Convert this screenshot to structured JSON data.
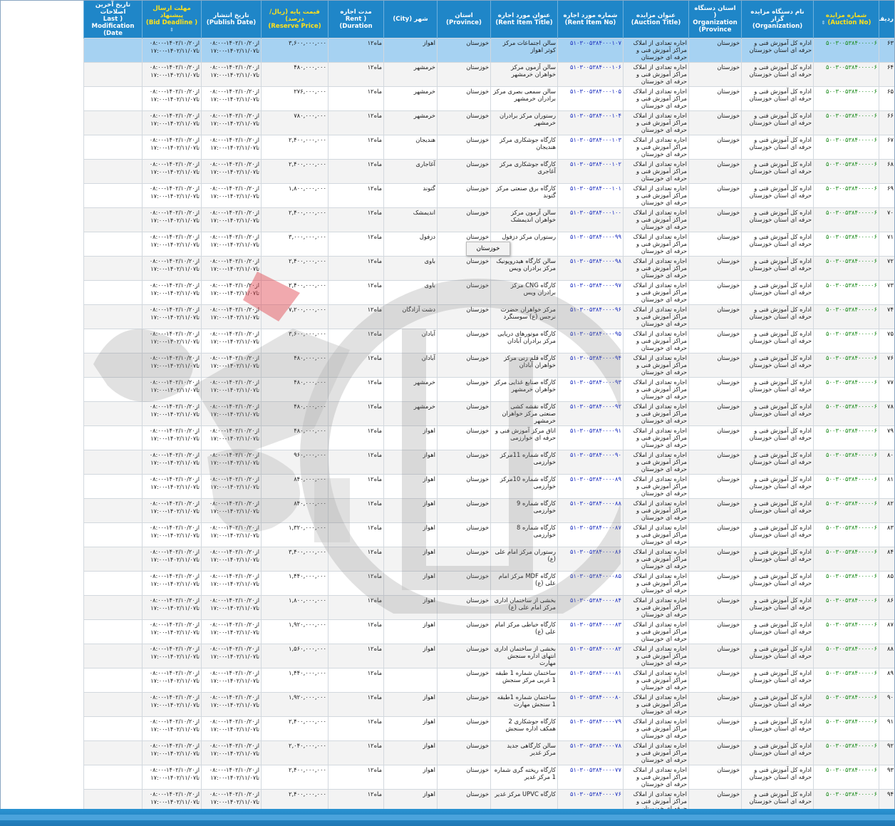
{
  "headers": {
    "row_no": "ردیف",
    "auction_no": "شماره مزایده",
    "auction_no_en": "(Auction No)",
    "organization": "نام دستگاه مزایده گزار",
    "organization_en": "(Organization)",
    "org_province": "استان دستگاه",
    "org_province_en": "( Organization Province)",
    "auction_title": "عنوان مزایده",
    "auction_title_en": "(Auction Title)",
    "rent_item_no": "شماره مورد اجاره",
    "rent_item_no_en": "(Rent Item No)",
    "rent_item_title": "عنوان مورد اجاره",
    "rent_item_title_en": "(Rent Item Title)",
    "province": "استان",
    "province_en": "(Province)",
    "city": "شهر (City)",
    "duration": "مدت اجاره",
    "duration_en": "( Rent Duration)",
    "reserve_price": "قیمت پایه (ریال/درصد)",
    "reserve_price_en": "(Reserve Price)",
    "publish_date": "تاریخ انتشار",
    "publish_date_en": "(Publish Date)",
    "deadline": "مهلت ارسال پیشنهاد",
    "deadline_en": "( Bid Deadline)",
    "modification": "تاریخ آخرین اصلاحات",
    "modification_en": "( Last Modification Date)"
  },
  "common": {
    "auction_no": "۵۰۰۳۰۰۵۳۸۴۰۰۰۰۰۶",
    "organization": "اداره کل آموزش فنی و حرفه ای استان خوزستان",
    "org_province": "خوزستان",
    "auction_title": "اجاره تعدادی از املاک مراکز آموزش فنی و حرفه ای خوزستان",
    "province": "خوزستان",
    "duration": "۱۲ماه",
    "publish_date": "از۱۴۰۲/۱۰/۲۰-۰۸:۰۰ تا۱۴۰۲/۱۱/۰۷-۱۷:۰۰",
    "deadline": "از۱۴۰۲/۱۰/۲۰-۰۸:۰۰ تا۱۴۰۲/۱۱/۰۷-۱۷:۰۰"
  },
  "rows": [
    {
      "n": "۶۳",
      "rno": "۵۱۰۳۰۰۵۳۸۴۰۰۰۱۰۷",
      "title": "سالن اجتماعات مرکز کوثر اهواز",
      "city": "اهواز",
      "price": "۳,۶۰۰,۰۰۰,۰۰۰",
      "state": "selected"
    },
    {
      "n": "۶۴",
      "rno": "۵۱۰۳۰۰۵۳۸۴۰۰۰۱۰۶",
      "title": "سالن آزمون مرکز خواهران خرمشهر",
      "city": "خرمشهر",
      "price": "۴۸۰,۰۰۰,۰۰۰",
      "state": "alt"
    },
    {
      "n": "۶۵",
      "rno": "۵۱۰۳۰۰۵۳۸۴۰۰۰۱۰۵",
      "title": "سالن سمعی بصری مرکز برادران خرمشهر",
      "city": "خرمشهر",
      "price": "۲۷۶,۰۰۰,۰۰۰",
      "state": "plain"
    },
    {
      "n": "۶۶",
      "rno": "۵۱۰۳۰۰۵۳۸۴۰۰۰۱۰۴",
      "title": "رستوران مرکز برادران خرمشهر",
      "city": "خرمشهر",
      "price": "۷۸۰,۰۰۰,۰۰۰",
      "state": "alt"
    },
    {
      "n": "۶۷",
      "rno": "۵۱۰۳۰۰۵۳۸۴۰۰۰۱۰۳",
      "title": "کارگاه جوشکاری مرکز هندیجان",
      "city": "هندیجان",
      "price": "۲,۴۰۰,۰۰۰,۰۰۰",
      "state": "plain"
    },
    {
      "n": "۶۸",
      "rno": "۵۱۰۳۰۰۵۳۸۴۰۰۰۱۰۲",
      "title": "کارگاه جوشکاری مرکز آغاجری",
      "city": "آغاجاری",
      "price": "۲,۴۰۰,۰۰۰,۰۰۰",
      "state": "alt"
    },
    {
      "n": "۶۹",
      "rno": "۵۱۰۳۰۰۵۳۸۴۰۰۰۱۰۱",
      "title": "کارگاه برق صنعتی مرکز گتوند",
      "city": "گتوند",
      "price": "۱,۸۰۰,۰۰۰,۰۰۰",
      "state": "plain"
    },
    {
      "n": "۷۰",
      "rno": "۵۱۰۳۰۰۵۳۸۴۰۰۰۱۰۰",
      "title": "سالن آزمون مرکز خواهران اندیمشک",
      "city": "اندیمشک",
      "price": "۲,۴۰۰,۰۰۰,۰۰۰",
      "state": "alt"
    },
    {
      "n": "۷۱",
      "rno": "۵۱۰۳۰۰۵۳۸۴۰۰۰۰۹۹",
      "title": "رستوران مرکز دزفول",
      "city": "دزفول",
      "price": "۳,۰۰۰,۰۰۰,۰۰۰",
      "state": "plain"
    },
    {
      "n": "۷۲",
      "rno": "۵۱۰۳۰۰۵۳۸۴۰۰۰۰۹۸",
      "title": "سالن کارگاه هیدروپونیک مرکز برادران ویس",
      "city": "باوی",
      "price": "۲,۴۰۰,۰۰۰,۰۰۰",
      "state": "alt"
    },
    {
      "n": "۷۳",
      "rno": "۵۱۰۳۰۰۵۳۸۴۰۰۰۰۹۷",
      "title": "کارگاه CNG مرکز برادران ویس",
      "city": "باوی",
      "price": "۲,۴۰۰,۰۰۰,۰۰۰",
      "state": "plain"
    },
    {
      "n": "۷۴",
      "rno": "۵۱۰۳۰۰۵۳۸۴۰۰۰۰۹۶",
      "title": "مرکز خواهران حضرت نرجس (ع) سوسنگرد",
      "city": "دشت آزادگان",
      "price": "۷,۲۰۰,۰۰۰,۰۰۰",
      "state": "alt"
    },
    {
      "n": "۷۵",
      "rno": "۵۱۰۳۰۰۵۳۸۴۰۰۰۰۹۵",
      "title": "کارگاه موتورهای دریایی مرکز برادران آبادان",
      "city": "آبادان",
      "price": "۳,۶۰۰,۰۰۰,۰۰۰",
      "state": "plain"
    },
    {
      "n": "۷۶",
      "rno": "۵۱۰۳۰۰۵۳۸۴۰۰۰۰۹۴",
      "title": "کارگاه قلم زنی مرکز خواهران آبادان",
      "city": "آبادان",
      "price": "۴۸۰,۰۰۰,۰۰۰",
      "state": "alt"
    },
    {
      "n": "۷۷",
      "rno": "۵۱۰۳۰۰۵۳۸۴۰۰۰۰۹۳",
      "title": "کارگاه صنایع غذایی مرکز خواهران خرمشهر",
      "city": "خرمشهر",
      "price": "۴۸۰,۰۰۰,۰۰۰",
      "state": "plain"
    },
    {
      "n": "۷۸",
      "rno": "۵۱۰۳۰۰۵۳۸۴۰۰۰۰۹۲",
      "title": "کارگاه نقشه کشی صنعتی مرکز خواهران خرمشهر",
      "city": "خرمشهر",
      "price": "۴۸۰,۰۰۰,۰۰۰",
      "state": "alt"
    },
    {
      "n": "۷۹",
      "rno": "۵۱۰۳۰۰۵۳۸۴۰۰۰۰۹۱",
      "title": "اتاق مرکز آموزش فنی و حرفه ای خوارزمی",
      "city": "اهواز",
      "price": "۴۸۰,۰۰۰,۰۰۰",
      "state": "plain"
    },
    {
      "n": "۸۰",
      "rno": "۵۱۰۳۰۰۵۳۸۴۰۰۰۰۹۰",
      "title": "کارگاه شماره 11مرکز خوارزمی",
      "city": "اهواز",
      "price": "۹۶۰,۰۰۰,۰۰۰",
      "state": "alt"
    },
    {
      "n": "۸۱",
      "rno": "۵۱۰۳۰۰۵۳۸۴۰۰۰۰۸۹",
      "title": "کارگاه شماره 10مرکز خوارزمی",
      "city": "اهواز",
      "price": "۸۴۰,۰۰۰,۰۰۰",
      "state": "plain"
    },
    {
      "n": "۸۲",
      "rno": "۵۱۰۳۰۰۵۳۸۴۰۰۰۰۸۸",
      "title": "کارگاه شماره 9 خوارزمی",
      "city": "اهواز",
      "price": "۸۴۰,۰۰۰,۰۰۰",
      "state": "alt"
    },
    {
      "n": "۸۳",
      "rno": "۵۱۰۳۰۰۵۳۸۴۰۰۰۰۸۷",
      "title": "کارگاه شماره 8 خوارزمی",
      "city": "اهواز",
      "price": "۱,۳۲۰,۰۰۰,۰۰۰",
      "state": "plain"
    },
    {
      "n": "۸۴",
      "rno": "۵۱۰۳۰۰۵۳۸۴۰۰۰۰۸۶",
      "title": "رستوران مرکز امام علی (ع)",
      "city": "اهواز",
      "price": "۳,۴۰۰,۰۰۰,۰۰۰",
      "state": "alt"
    },
    {
      "n": "۸۵",
      "rno": "۵۱۰۳۰۰۵۳۸۴۰۰۰۰۸۵",
      "title": "کارگاه MDF مرکز امام علی (ع)",
      "city": "اهواز",
      "price": "۱,۴۴۰,۰۰۰,۰۰۰",
      "state": "plain"
    },
    {
      "n": "۸۶",
      "rno": "۵۱۰۳۰۰۵۳۸۴۰۰۰۰۸۴",
      "title": "بخشی از ساختمان اداری مرکز امام علی (ع)",
      "city": "اهواز",
      "price": "۱,۸۰۰,۰۰۰,۰۰۰",
      "state": "alt"
    },
    {
      "n": "۸۷",
      "rno": "۵۱۰۳۰۰۵۳۸۴۰۰۰۰۸۳",
      "title": "کارگاه خیاطی مرکز امام علی (ع)",
      "city": "اهواز",
      "price": "۱,۹۲۰,۰۰۰,۰۰۰",
      "state": "plain"
    },
    {
      "n": "۸۸",
      "rno": "۵۱۰۳۰۰۵۳۸۴۰۰۰۰۸۲",
      "title": "بخشی از ساختمان اداری انتهای اداره سنجش مهارت",
      "city": "اهواز",
      "price": "۱,۵۶۰,۰۰۰,۰۰۰",
      "state": "alt"
    },
    {
      "n": "۸۹",
      "rno": "۵۱۰۳۰۰۵۳۸۴۰۰۰۰۸۱",
      "title": "ساختمان شماره 1 طبقه 1 غربی مرکز سنجش",
      "city": "",
      "price": "۱,۴۴۰,۰۰۰,۰۰۰",
      "state": "plain"
    },
    {
      "n": "۹۰",
      "rno": "۵۱۰۳۰۰۵۳۸۴۰۰۰۰۸۰",
      "title": "ساختمان شماره 1طبقه 1 سنجش مهارت",
      "city": "اهواز",
      "price": "۱,۹۲۰,۰۰۰,۰۰۰",
      "state": "alt"
    },
    {
      "n": "۹۱",
      "rno": "۵۱۰۳۰۰۵۳۸۴۰۰۰۰۷۹",
      "title": "کارگاه جوشکاری 2 همکف اداره سنجش",
      "city": "اهواز",
      "price": "۲,۴۰۰,۰۰۰,۰۰۰",
      "state": "plain"
    },
    {
      "n": "۹۲",
      "rno": "۵۱۰۳۰۰۵۳۸۴۰۰۰۰۷۸",
      "title": "سالن کارگاهی جدید مرکز غدیر",
      "city": "اهواز",
      "price": "۲,۰۴۰,۰۰۰,۰۰۰",
      "state": "alt"
    },
    {
      "n": "۹۳",
      "rno": "۵۱۰۳۰۰۵۳۸۴۰۰۰۰۷۷",
      "title": "کارگاه ریخته گری شماره 1 مرکز غدیر",
      "city": "اهواز",
      "price": "۲,۴۰۰,۰۰۰,۰۰۰",
      "state": "plain"
    },
    {
      "n": "۹۴",
      "rno": "۵۱۰۳۰۰۵۳۸۴۰۰۰۰۷۶",
      "title": "کارگاه UPVC مرکز غدیر",
      "city": "اهواز",
      "price": "۲,۴۰۰,۰۰۰,۰۰۰",
      "state": "alt"
    }
  ],
  "tooltip": {
    "text": "خوزستان"
  },
  "colors": {
    "header_bg": "#1f86c8",
    "header_text": "#ffffff",
    "header_highlight": "#ffe11a",
    "auction_no": "#1a8a1a",
    "rent_item_no": "#1c2fbf",
    "selected_row": "#a6d2f2",
    "alt_row": "#f3f3f3"
  },
  "icons": {
    "sort": "sort-arrows-icon",
    "watermark": "logo-watermark"
  }
}
